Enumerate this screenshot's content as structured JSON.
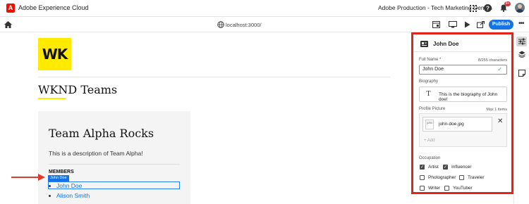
{
  "topbar": {
    "app_name": "Adobe Experience Cloud",
    "org_name": "Adobe Production - Tech Marketing Demos",
    "notification_count": "9+",
    "icons": [
      "adobe-logo",
      "apps-grid-icon",
      "help-icon",
      "bell-icon",
      "avatar"
    ]
  },
  "toolbar": {
    "url": "localhost:3000/",
    "publish_label": "Publish",
    "accent": "#1473e6"
  },
  "page": {
    "logo_text": "WK",
    "title": "WKND Teams",
    "team": {
      "title": "Team Alpha Rocks",
      "description": "This is a description of Team Alpha!",
      "members_heading": "MEMBERS",
      "selected_tag": "John Doe",
      "members": [
        "John Doe",
        "Alison Smith"
      ]
    }
  },
  "panel": {
    "title": "John Doe",
    "highlight_color": "#e1251b",
    "full_name": {
      "label": "Full Name",
      "required_mark": "*",
      "hint": "8/255 characters",
      "value": "John Doe"
    },
    "biography": {
      "label": "Biography",
      "value": "This is the biography of John doe!"
    },
    "profile_picture": {
      "label": "Profile Picture",
      "hint": "Max 1 items",
      "thumb_alt": "john",
      "file_name": "john-doe.jpg",
      "add_label": "+ Add"
    },
    "occupation": {
      "label": "Occupation",
      "options": [
        {
          "label": "Artist",
          "checked": true
        },
        {
          "label": "Influencer",
          "checked": true
        },
        {
          "label": "Photographer",
          "checked": false
        },
        {
          "label": "Traveler",
          "checked": false
        },
        {
          "label": "Writer",
          "checked": false
        },
        {
          "label": "YouTuber",
          "checked": false
        }
      ]
    }
  }
}
